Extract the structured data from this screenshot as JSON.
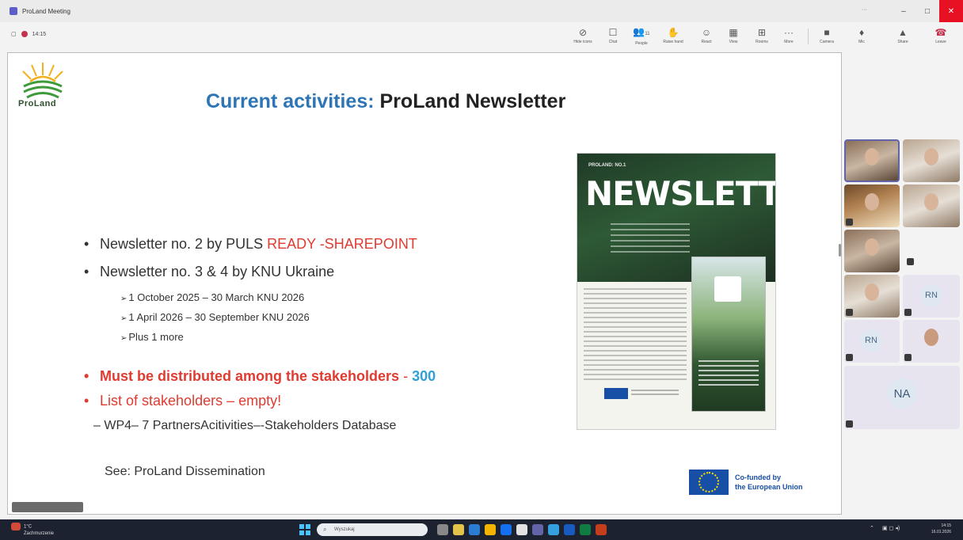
{
  "window": {
    "title": "ProLand Meeting",
    "controls": {
      "minimize": "–",
      "maximize": "□",
      "close": "✕"
    }
  },
  "meeting": {
    "timer": "14:15",
    "toolbar": [
      {
        "id": "hide-icons",
        "label": "Hide icons",
        "glyph": "⊘"
      },
      {
        "id": "chat",
        "label": "Chat",
        "glyph": "☐"
      },
      {
        "id": "people",
        "label": "People",
        "glyph": "👥",
        "count": "11"
      },
      {
        "id": "raise",
        "label": "Raise hand",
        "glyph": "✋"
      },
      {
        "id": "react",
        "label": "React",
        "glyph": "☺"
      },
      {
        "id": "view",
        "label": "View",
        "glyph": "▦"
      },
      {
        "id": "rooms",
        "label": "Rooms",
        "glyph": "⊞"
      },
      {
        "id": "more",
        "label": "More",
        "glyph": "···"
      },
      {
        "id": "camera",
        "label": "Camera",
        "glyph": "■"
      },
      {
        "id": "mic",
        "label": "Mic",
        "glyph": "♦"
      },
      {
        "id": "share",
        "label": "Share",
        "glyph": "▲"
      },
      {
        "id": "leave",
        "label": "Leave",
        "glyph": "☎"
      }
    ]
  },
  "slide": {
    "logo_text": "ProLand",
    "title_highlight": "Current activities:",
    "title_rest": "ProLand Newsletter",
    "bullets": {
      "b1_text": "Newsletter no. 2 by PULS ",
      "b1_status": "READY -SHAREPOINT",
      "b2_text": "Newsletter no. 3 & 4 by KNU Ukraine",
      "sub1": "1 October 2025 – 30 March KNU 2026",
      "sub2": "1 April 2026 – 30 September  KNU 2026",
      "sub3": "Plus 1 more",
      "b3_text": "Must be distributed among the stakeholders",
      "b3_sep": " - ",
      "b3_count": "300",
      "b4_text": "List of stakeholders – empty!",
      "b5_text": "– WP4– 7 PartnersAcitivities–-Stakeholders  Database"
    },
    "see_text": "See: ProLand Dissemination",
    "newsletter": {
      "small_label": "PROLAND: NO.1",
      "big_title": "NEWSLETTER"
    },
    "eu_text_line1": "Co-funded by",
    "eu_text_line2": "the European Union"
  },
  "participants": {
    "avatars": [
      "RN",
      "RN",
      "NA"
    ]
  },
  "taskbar": {
    "weather_temp": "1°C",
    "weather_desc": "Zachmurzenie",
    "search_placeholder": "Wyszukaj",
    "time": "14:15",
    "date": "16.01.2026"
  }
}
